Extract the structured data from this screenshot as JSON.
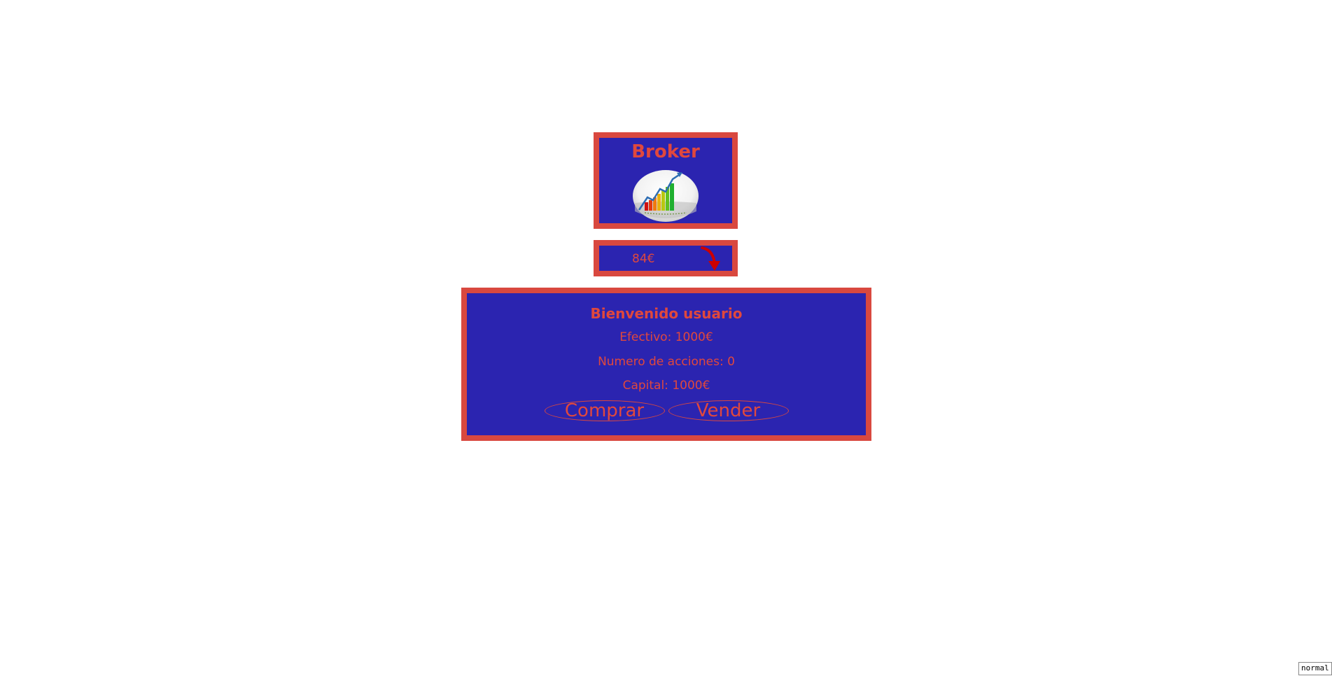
{
  "header": {
    "title": "Broker",
    "logo_icon": "rising-bar-chart-icon"
  },
  "price_ticker": {
    "price": "84€",
    "trend_icon": "down-arrow-icon",
    "trend_color": "#cc0000"
  },
  "account": {
    "welcome": "Bienvenido usuario",
    "efectivo": "Efectivo: 1000€",
    "acciones": "Numero de acciones: 0",
    "capital": "Capital: 1000€"
  },
  "actions": {
    "buy_label": "Comprar",
    "sell_label": "Vender"
  },
  "mode_indicator": "normal",
  "colors": {
    "panel_background": "#2b24b0",
    "panel_border": "#d9483f",
    "text": "#e0483d"
  }
}
